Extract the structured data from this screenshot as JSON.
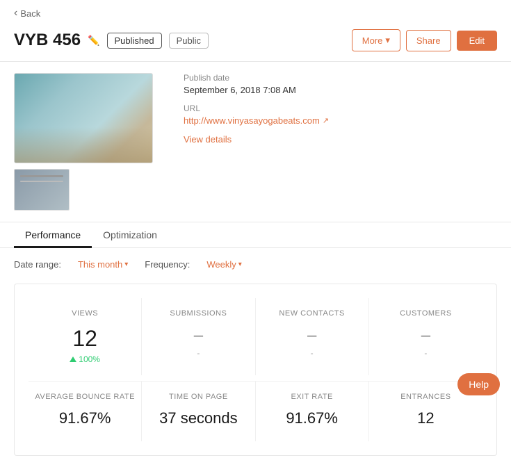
{
  "back": {
    "label": "Back"
  },
  "header": {
    "title": "VYB 456",
    "badge_published": "Published",
    "badge_public": "Public",
    "btn_more": "More",
    "btn_share": "Share",
    "btn_edit": "Edit"
  },
  "meta": {
    "publish_date_label": "Publish date",
    "publish_date_value": "September 6, 2018 7:08 AM",
    "url_label": "URL",
    "url_value": "http://www.vinyasayogabeats.com",
    "view_details_label": "View details"
  },
  "tabs": [
    {
      "label": "Performance",
      "active": true
    },
    {
      "label": "Optimization",
      "active": false
    }
  ],
  "filters": {
    "date_range_label": "Date range:",
    "date_range_value": "This month",
    "frequency_label": "Frequency:",
    "frequency_value": "Weekly"
  },
  "stats_top": [
    {
      "label": "VIEWS",
      "value": "12",
      "change": "100%",
      "has_change": true,
      "is_dash": false
    },
    {
      "label": "SUBMISSIONS",
      "value": "–",
      "sub": "-",
      "has_change": false,
      "is_dash": true
    },
    {
      "label": "NEW CONTACTS",
      "value": "–",
      "sub": "-",
      "has_change": false,
      "is_dash": true
    },
    {
      "label": "CUSTOMERS",
      "value": "–",
      "sub": "-",
      "has_change": false,
      "is_dash": true
    }
  ],
  "stats_bottom": [
    {
      "label": "AVERAGE BOUNCE RATE",
      "value": "91.67%"
    },
    {
      "label": "TIME ON PAGE",
      "value": "37 seconds"
    },
    {
      "label": "EXIT RATE",
      "value": "91.67%"
    },
    {
      "label": "ENTRANCES",
      "value": "12"
    }
  ],
  "help": {
    "label": "Help"
  }
}
